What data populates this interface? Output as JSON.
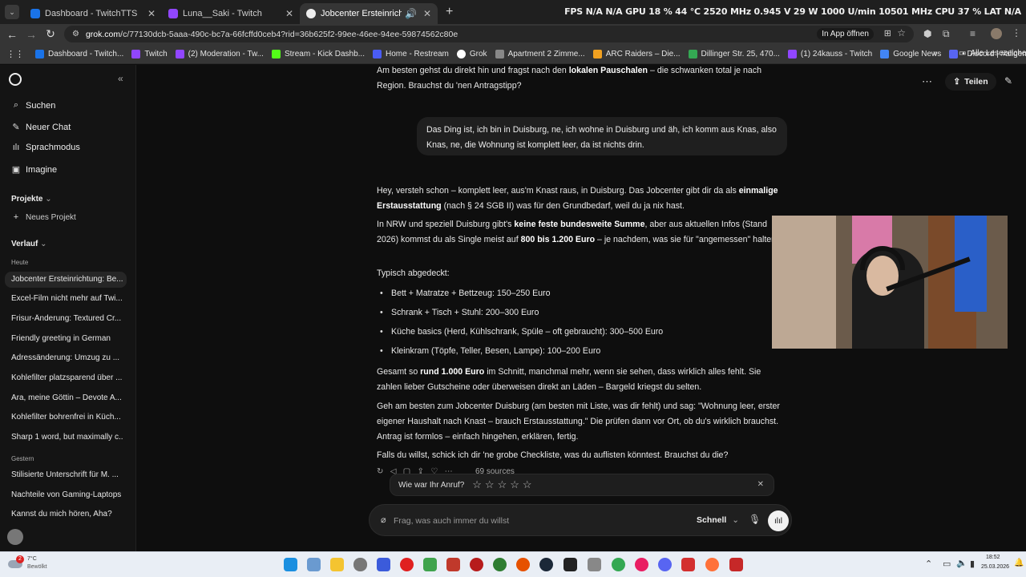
{
  "browser": {
    "tabs": [
      {
        "title": "Dashboard - TwitchTTS",
        "color": "#1a73e8"
      },
      {
        "title": "Luna__Saki - Twitch",
        "color": "#9146ff"
      },
      {
        "title": "Jobcenter Ersteinrichtung: [",
        "color": "#eeeeee",
        "active": true
      }
    ],
    "new_tab": "+",
    "hwinfo": "FPS  N/A  N/A   GPU  18 %  44 °C  2520 MHz  0.945 V  29 W  1000 U/min  10501 MHz   CPU  37 %   LAT  N/A",
    "url_host": "grok.com",
    "url_path": "/c/77130dcb-5aaa-490c-bc7a-66fcffd0ceb4?rid=36b625f2-99ee-46ee-94ee-59874562c80e",
    "open_in_app": "In App öffnen",
    "bookmarks": [
      {
        "label": "Dashboard - Twitch...",
        "color": "#1a73e8"
      },
      {
        "label": "Twitch",
        "color": "#9146ff"
      },
      {
        "label": "(2) Moderation - Tw...",
        "color": "#9146ff"
      },
      {
        "label": "Stream - Kick Dashb...",
        "color": "#53fc18"
      },
      {
        "label": "Home - Restream",
        "color": "#4a5cf5"
      },
      {
        "label": "Grok",
        "color": "#ffffff"
      },
      {
        "label": "Apartment 2 Zimme...",
        "color": "#888888"
      },
      {
        "label": "ARC Raiders – Die...",
        "color": "#f0a020"
      },
      {
        "label": "Dillinger Str. 25, 470...",
        "color": "#34a853"
      },
      {
        "label": "(1) 24kauss - Twitch",
        "color": "#9146ff"
      },
      {
        "label": "Google News",
        "color": "#4285f4"
      },
      {
        "label": "• Discord | #allgeme...",
        "color": "#5865f2"
      }
    ],
    "all_bookmarks": "Alle Lesezeichen"
  },
  "sidebar": {
    "nav": [
      {
        "label": "Suchen",
        "icon": "search-icon"
      },
      {
        "label": "Neuer Chat",
        "icon": "new-chat-icon"
      },
      {
        "label": "Sprachmodus",
        "icon": "voice-mode-icon"
      },
      {
        "label": "Imagine",
        "icon": "image-icon"
      }
    ],
    "projects_label": "Projekte",
    "new_project": "Neues Projekt",
    "history_label": "Verlauf",
    "today_label": "Heute",
    "today": [
      "Jobcenter Ersteinrichtung: Be...",
      "Excel-Film nicht mehr auf Twi...",
      "Frisur-Änderung: Textured Cr...",
      "Friendly greeting in German",
      "Adressänderung: Umzug zu ...",
      "Kohlefilter platzsparend über ...",
      "Ara, meine Göttin – Devote A...",
      "Kohlefilter bohrenfrei in Küch...",
      "Sharp 1 word, but maximally c..."
    ],
    "yesterday_label": "Gestern",
    "yesterday": [
      "Stilisierte Unterschrift für M. ...",
      "Nachteile von Gaming-Laptops",
      "Kannst du mich hören, Aha?"
    ]
  },
  "chat": {
    "share": "Teilen",
    "prev_line1_pre": "Am besten gehst du direkt hin und fragst nach den ",
    "prev_line1_bold": "lokalen Pauschalen",
    "prev_line1_post": " – die schwanken total je nach",
    "prev_line2": "Region. Brauchst du 'nen Antragstipp?",
    "user_message": "Das Ding ist, ich bin in Duisburg, ne, ich wohne in Duisburg und äh, ich komm aus Knas, also Knas, ne, die Wohnung ist komplett leer, da ist nichts drin.",
    "p1_a": "Hey, versteh schon – komplett leer, aus'm Knast raus, in Duisburg. Das Jobcenter gibt dir da als ",
    "p1_bold": "einmalige Erstausstattung",
    "p1_b": " (nach § 24 SGB II) was für den Grundbedarf, weil du ja nix hast.",
    "p2_a": "In NRW und speziell Duisburg gibt's ",
    "p2_bold1": "keine feste bundesweite Summe",
    "p2_b": ", aber aus aktuellen Infos (Stand 2026) kommst du als Single meist auf ",
    "p2_bold2": "800 bis 1.200 Euro",
    "p2_c": " – je nachdem, was sie für \"angemessen\" halten.",
    "covered_label": "Typisch abgedeckt:",
    "items": [
      "Bett + Matratze + Bettzeug: 150–250 Euro",
      "Schrank + Tisch + Stuhl: 200–300 Euro",
      "Küche basics (Herd, Kühlschrank, Spüle – oft gebraucht): 300–500 Euro",
      "Kleinkram (Töpfe, Teller, Besen, Lampe): 100–200 Euro"
    ],
    "p3_a": "Gesamt so ",
    "p3_bold": "rund 1.000 Euro",
    "p3_b": " im Schnitt, manchmal mehr, wenn sie sehen, dass wirklich alles fehlt. Sie zahlen lieber Gutscheine oder überweisen direkt an Läden – Bargeld kriegst du selten.",
    "p4": "Geh am besten zum Jobcenter Duisburg (am besten mit Liste, was dir fehlt) und sag: \"Wohnung leer, erster eigener Haushalt nach Knast – brauch Erstausstattung.\" Die prüfen dann vor Ort, ob du's wirklich brauchst. Antrag ist formlos – einfach hingehen, erklären, fertig.",
    "p5": "Falls du willst, schick ich dir 'ne grobe Checkliste, was du auflisten könntest. Brauchst du die?",
    "sources": "69 sources",
    "rating_prompt": "Wie war Ihr Anruf?",
    "rating_value": 0,
    "rating_max": 5,
    "composer_placeholder": "Frag, was auch immer du willst",
    "model": "Schnell"
  },
  "taskbar": {
    "weather_temp": "7°C",
    "weather_desc": "Bewölkt",
    "notification_count": "2",
    "time": "18:52",
    "date": "25.03.2026"
  }
}
